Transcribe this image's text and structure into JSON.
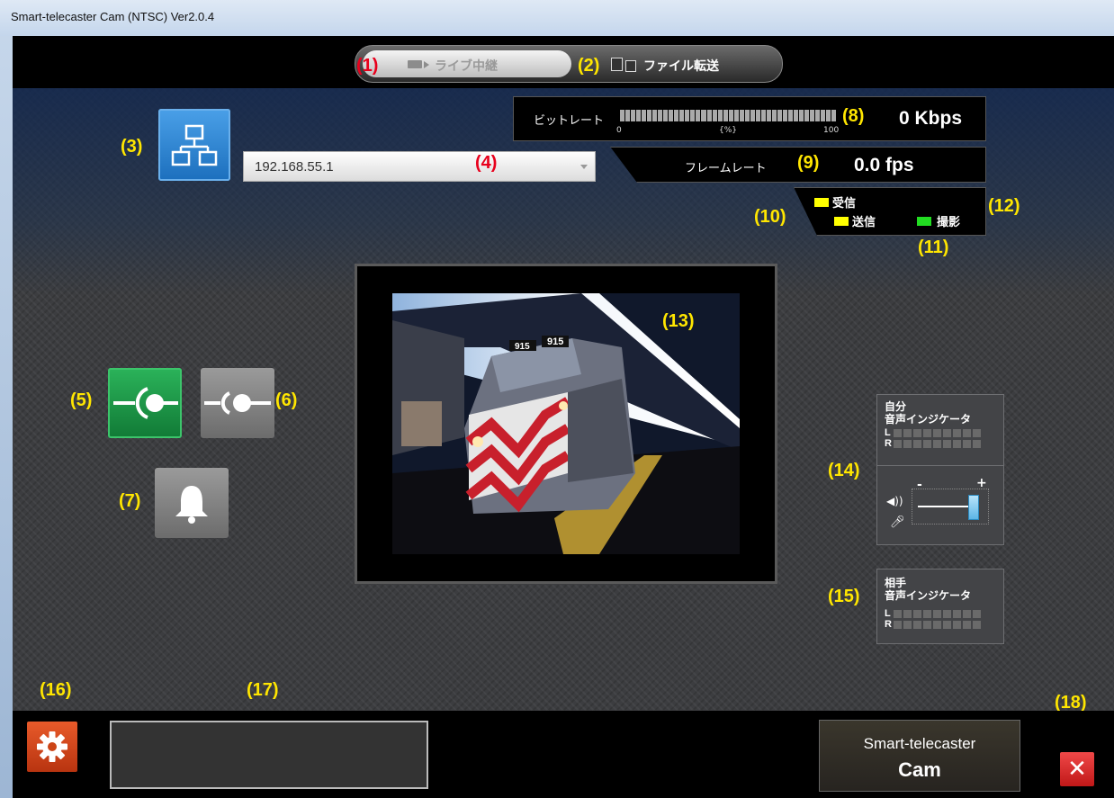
{
  "window": {
    "title": "Smart-telecaster Cam (NTSC) Ver2.0.4"
  },
  "mode_tabs": [
    {
      "label": "ライブ中継",
      "number": "(1)"
    },
    {
      "label": "ファイル転送",
      "number": "(2)"
    }
  ],
  "network": {
    "number": "(3)",
    "icon": "network-icon"
  },
  "ip": {
    "value": "192.168.55.1",
    "number": "(4)"
  },
  "bitrate": {
    "label": "ビットレート",
    "value": "0 Kbps",
    "scale_min": "0",
    "scale_unit": "{%}",
    "scale_max": "100",
    "number": "(8)",
    "level": 0
  },
  "framerate": {
    "label": "フレームレート",
    "value": "0.0 fps",
    "number": "(9)"
  },
  "status": {
    "receive_label": "受信",
    "send_label": "送信",
    "capture_label": "撮影",
    "receive_color": "#ffff00",
    "send_color": "#ffff00",
    "capture_color": "#22dd22",
    "num_send": "(10)",
    "num_capture": "(11)",
    "num_receive": "(12)"
  },
  "video": {
    "number": "(13)",
    "train_numbers": [
      "915",
      "915"
    ]
  },
  "controls": {
    "connect_number": "(5)",
    "disconnect_number": "(6)",
    "bell_number": "(7)",
    "connect_color": "#1a8f42"
  },
  "self_audio": {
    "title": "自分\n音声インジケータ",
    "number": "(14)",
    "left": "L",
    "right": "R",
    "minus": "-",
    "plus": "+",
    "volume_level": 0.9
  },
  "peer_audio": {
    "title": "相手\n音声インジケータ",
    "number": "(15)",
    "left": "L",
    "right": "R"
  },
  "bottom": {
    "settings_number": "(16)",
    "status_number": "(17)",
    "close_number": "(18)",
    "logo_line1": "Smart-telecaster",
    "logo_line2": "Cam",
    "close_glyph": "✕"
  }
}
